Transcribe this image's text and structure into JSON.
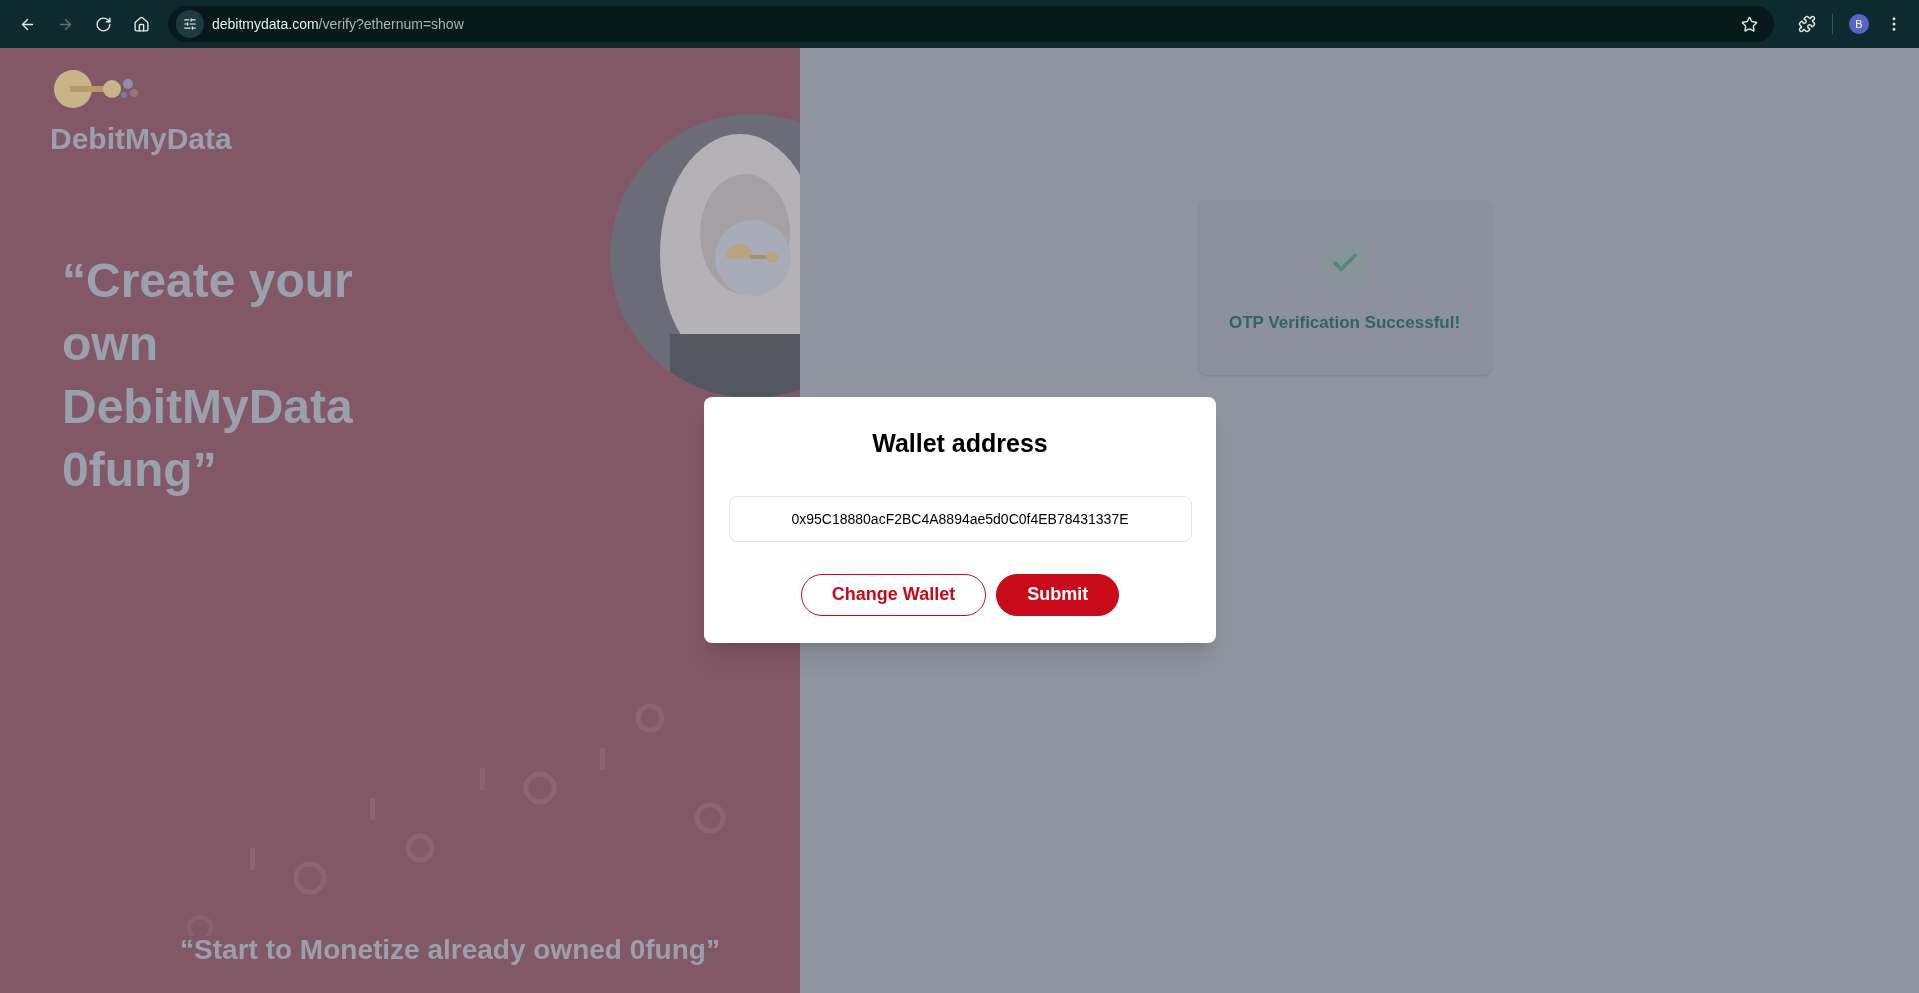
{
  "browser": {
    "nav": [
      {
        "kind": "back",
        "disabled": false
      },
      {
        "kind": "forward",
        "disabled": true
      },
      {
        "kind": "reload",
        "disabled": false
      },
      {
        "kind": "home",
        "disabled": false
      }
    ],
    "url_host": "debitmydata.com",
    "url_path": "/verify?ethernum=show",
    "profile_initial": "B"
  },
  "brand": {
    "name": "DebitMyData"
  },
  "hero": {
    "quote": "“Create your own DebitMyData 0fung”",
    "tagline": "“Start to Monetize already owned 0fung”"
  },
  "status_card": {
    "message": "OTP Verification Successful!"
  },
  "modal": {
    "title": "Wallet address",
    "wallet_field": {
      "value": "0x95C18880acF2BC4A8894ae5d0C0f4EB78431337E"
    },
    "buttons": [
      {
        "label": "Change Wallet",
        "kind": "outline"
      },
      {
        "label": "Submit",
        "kind": "primary"
      }
    ]
  }
}
